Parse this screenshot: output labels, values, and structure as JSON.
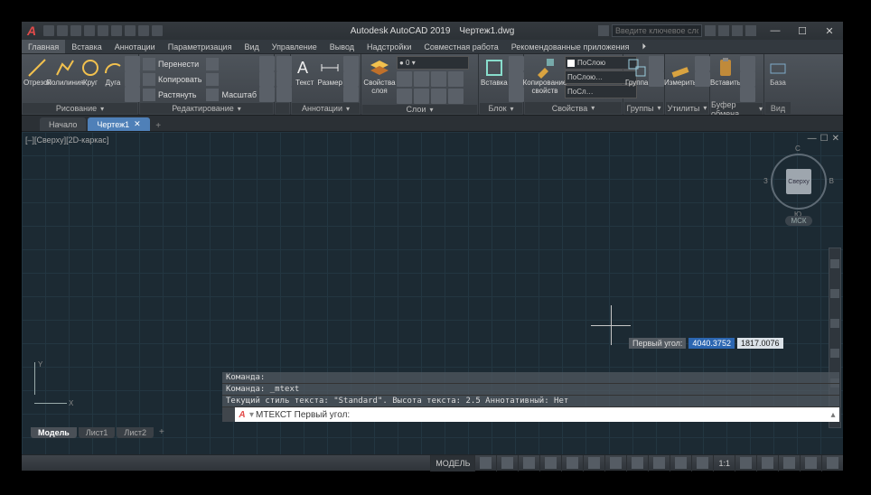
{
  "app": {
    "name": "Autodesk AutoCAD 2019",
    "doc": "Чертеж1.dwg",
    "search_placeholder": "Введите ключевое слово/фразу"
  },
  "wincontrols": {
    "min": "—",
    "max": "☐",
    "close": "✕"
  },
  "menutabs": [
    "Главная",
    "Вставка",
    "Аннотации",
    "Параметризация",
    "Вид",
    "Управление",
    "Вывод",
    "Надстройки",
    "Совместная работа",
    "Рекомендованные приложения",
    "⏵"
  ],
  "ribbon": {
    "draw": {
      "title": "Рисование",
      "seg": "Отрезок",
      "pline": "Полилиния",
      "circle": "Круг",
      "arc": "Дуга"
    },
    "modify": {
      "title": "Редактирование",
      "move": "Перенести",
      "copy": "Копировать",
      "stretch": "Растянуть",
      "scale": "Масштаб"
    },
    "annot": {
      "title": "Аннотации",
      "text": "Текст",
      "dim": "Размер"
    },
    "layers": {
      "title": "Слои",
      "btn": "Свойства\nслоя"
    },
    "block": {
      "title": "Блок",
      "insert": "Вставка",
      "edit": "Копирование\nсвойств"
    },
    "props": {
      "title": "Свойства",
      "bylayer": "ПоСлою",
      "bylayer2": "ПоСлою…",
      "bylayer3": "ПоСл…"
    },
    "groups": {
      "title": "Группы",
      "btn": "Группа"
    },
    "utils": {
      "title": "Утилиты",
      "btn": "Измерить"
    },
    "clip": {
      "title": "Буфер обмена",
      "btn": "Вставить"
    },
    "view": {
      "title": "Вид",
      "btn": "База"
    }
  },
  "drawtabs": {
    "start": "Начало",
    "active": "Чертеж1",
    "plus": "+"
  },
  "drawing": {
    "viewlabel": "[–][Сверху][2D-каркас]",
    "cursor_label": "Первый угол:",
    "xval": "4040.3752",
    "yval": "1817.0076",
    "cube": "Сверху",
    "compass": {
      "n": "С",
      "s": "Ю",
      "w": "З",
      "e": "В"
    },
    "msk": "МСК",
    "ucs": {
      "x": "X",
      "y": "Y"
    }
  },
  "cmd": {
    "h1": "Команда:",
    "h2": "Команда: _mtext",
    "h3": "Текущий стиль текста: \"Standard\". Высота текста: 2.5 Аннотативный: Нет",
    "prompt": "МТЕКСТ Первый угол:"
  },
  "btabs": {
    "model": "Модель",
    "l1": "Лист1",
    "l2": "Лист2",
    "plus": "+"
  },
  "status": {
    "model": "МОДЕЛЬ",
    "scale": "1:1"
  }
}
